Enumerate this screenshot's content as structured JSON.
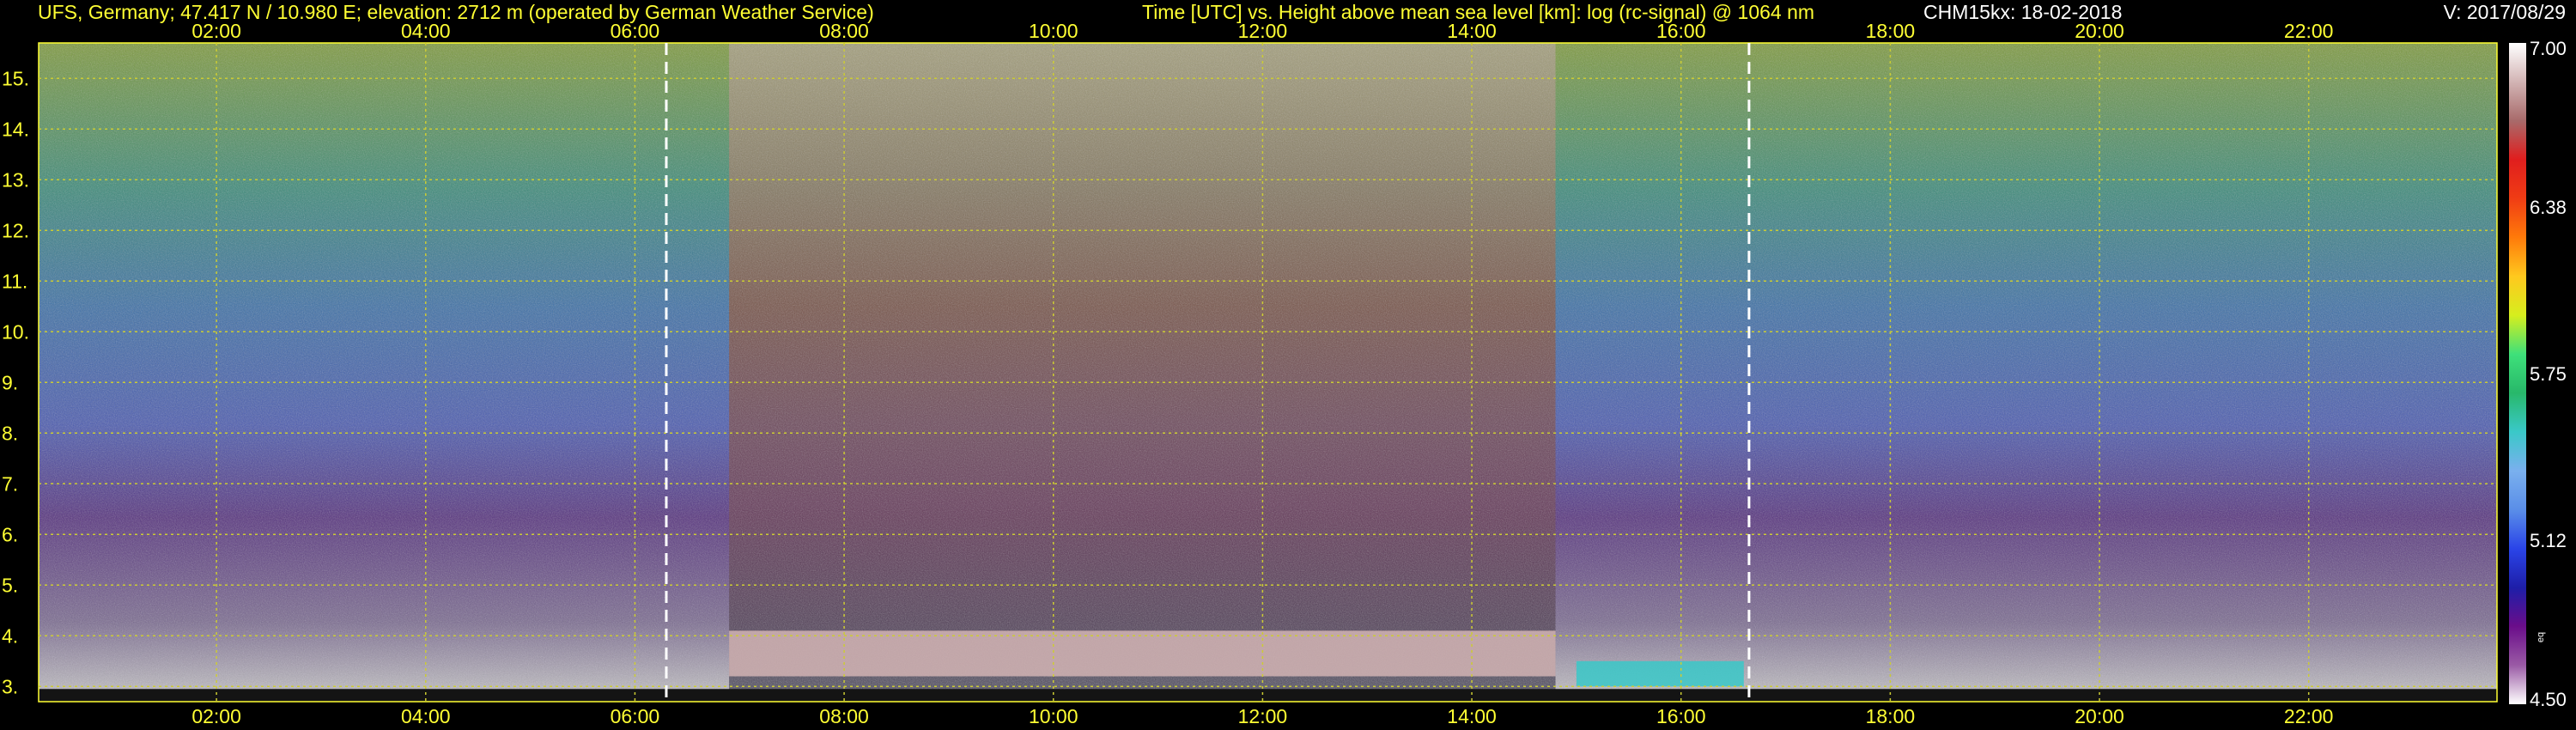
{
  "header": {
    "station": "UFS, Germany; 47.417 N / 10.980 E; elevation: 2712 m  (operated by German Weather Service)",
    "title": "Time [UTC] vs. Height above mean sea level [km]: log (rc-signal) @ 1064 nm",
    "instrument": "CHM15kx: 18-02-2018",
    "version": "V: 2017/08/29"
  },
  "chart_data": {
    "type": "heatmap",
    "title": "Time [UTC] vs. Height above mean sea level [km]: log (rc-signal) @ 1064 nm",
    "xlabel": "Time [UTC]",
    "ylabel": "Height above mean sea level [km]",
    "xlim": [
      0.3,
      23.8
    ],
    "ylim": [
      2.7,
      15.7
    ],
    "x_ticks": [
      2,
      4,
      6,
      8,
      10,
      12,
      14,
      16,
      18,
      20,
      22
    ],
    "x_tick_labels": [
      "02:00",
      "04:00",
      "06:00",
      "08:00",
      "10:00",
      "12:00",
      "14:00",
      "16:00",
      "18:00",
      "20:00",
      "22:00"
    ],
    "y_ticks": [
      3,
      4,
      5,
      6,
      7,
      8,
      9,
      10,
      11,
      12,
      13,
      14,
      15
    ],
    "y_tick_labels": [
      "3.",
      "4.",
      "5.",
      "6.",
      "7.",
      "8.",
      "9.",
      "10.",
      "11.",
      "12.",
      "13.",
      "14.",
      "15."
    ],
    "grid": true,
    "grid_color": "#cccc33",
    "sunrise_sunset_hours": [
      6.3,
      16.65
    ],
    "colorbar": {
      "min": 4.5,
      "max": 7.0,
      "tick_values": [
        4.5,
        5.12,
        5.75,
        6.38,
        7.0
      ],
      "tick_labels": [
        "4.50",
        "5.12",
        "5.75",
        "6.38",
        "7.00"
      ],
      "unit": "eq",
      "colors": [
        "#ffffff",
        "#9a5aa5",
        "#6a0d8a",
        "#1e1ea8",
        "#2a44e8",
        "#5a8ee8",
        "#7ab0ee",
        "#3ac8c8",
        "#28b86a",
        "#3ee07a",
        "#d6ee1e",
        "#ffc81e",
        "#ff7a0a",
        "#f03c14",
        "#e01e1e",
        "#a86a6a",
        "#d2b4b4",
        "#ffffff"
      ]
    },
    "cloud_layers": [
      {
        "start": 6.9,
        "end": 14.8,
        "base_km": 3.2,
        "top_km": 4.1,
        "value": 6.8
      },
      {
        "start": 15.0,
        "end": 16.6,
        "base_km": 3.0,
        "top_km": 3.5,
        "value": 5.5
      }
    ]
  }
}
